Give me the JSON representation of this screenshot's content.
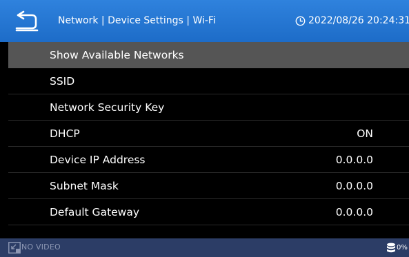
{
  "header": {
    "title": "Network | Device Settings | Wi-Fi",
    "datetime": "2022/08/26 20:24:31",
    "back_icon": "back-arrow-icon",
    "clock_icon": "clock-icon"
  },
  "list": {
    "items": [
      {
        "label": "Show Available Networks",
        "value": ""
      },
      {
        "label": "SSID",
        "value": ""
      },
      {
        "label": "Network Security Key",
        "value": ""
      },
      {
        "label": "DHCP",
        "value": "ON"
      },
      {
        "label": "Device IP Address",
        "value": "0.0.0.0"
      },
      {
        "label": "Subnet Mask",
        "value": "0.0.0.0"
      },
      {
        "label": "Default Gateway",
        "value": "0.0.0.0"
      }
    ],
    "selected_label": "Show Available Networks"
  },
  "footer": {
    "video_status": "NO VIDEO",
    "storage_percent": "0%",
    "video_icon": "video-input-icon",
    "storage_icon": "database-icon"
  },
  "colors": {
    "header_bg": "#2a7bd6",
    "selected_row_bg": "#555555",
    "list_bg": "#000000",
    "footer_bg": "#2c3d66"
  }
}
